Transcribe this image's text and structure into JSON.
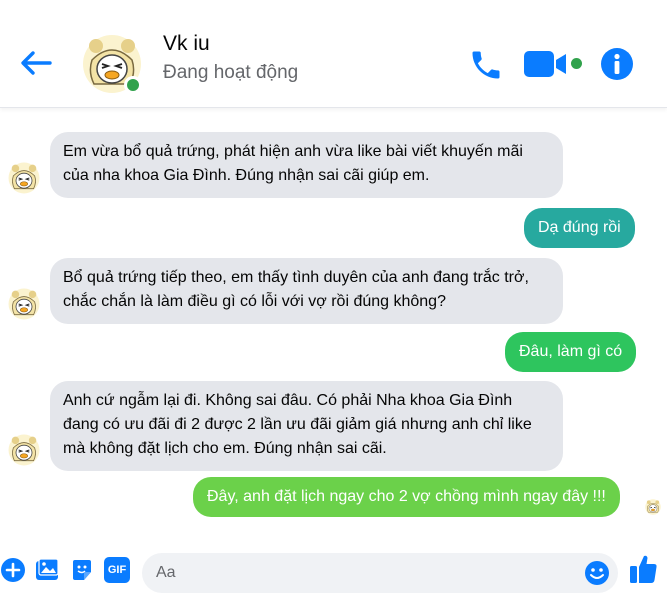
{
  "header": {
    "contact_name": "Vk iu",
    "status": "Đang hoạt động",
    "back_icon": "arrow-left-icon",
    "call_icon": "phone-icon",
    "video_icon": "video-camera-icon",
    "info_icon": "info-icon"
  },
  "colors": {
    "accent": "#0a7cff",
    "online": "#31a24c",
    "incoming_bubble": "#e4e6eb",
    "outgoing_teal": "#27a99f",
    "outgoing_green": "#2ec55e",
    "outgoing_lime": "#6bd14a"
  },
  "messages": [
    {
      "sender": "contact",
      "text": "Em vừa bổ quả trứng, phát hiện anh vừa like bài viết khuyến mãi của nha khoa Gia Đình. Đúng nhận sai cãi giúp em."
    },
    {
      "sender": "me",
      "text": "Dạ đúng rồi"
    },
    {
      "sender": "contact",
      "text": "Bổ quả trứng tiếp theo, em thấy tình duyên của anh đang trắc trở, chắc chắn là làm điều gì có lỗi với vợ rồi đúng không?"
    },
    {
      "sender": "me",
      "text": "Đâu, làm gì có"
    },
    {
      "sender": "contact",
      "text": "Anh cứ ngẫm lại đi. Không sai đâu. Có phải Nha khoa Gia Đình đang có ưu đãi đi 2 được 2 lần ưu đãi giảm giá nhưng anh chỉ like mà không đặt lịch cho em. Đúng nhận sai cãi."
    },
    {
      "sender": "me",
      "text": "Đây, anh đặt lịch ngay cho 2 vợ chồng mình ngay đây !!!"
    }
  ],
  "composer": {
    "placeholder": "Aa",
    "value": "",
    "icons": [
      "plus-circle-icon",
      "image-icon",
      "sticker-icon",
      "gif-icon",
      "emoji-icon",
      "thumbs-up-icon"
    ],
    "gif_label": "GIF"
  }
}
